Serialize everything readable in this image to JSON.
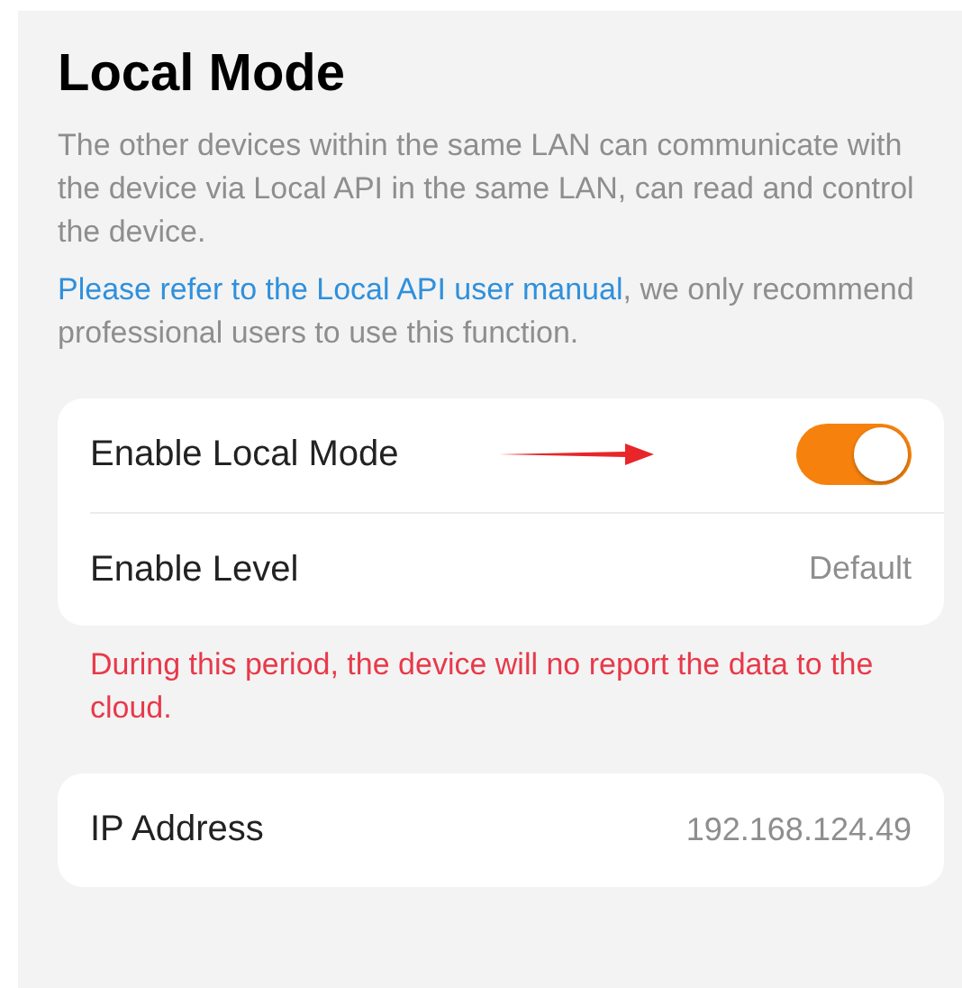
{
  "title": "Local Mode",
  "description": "The other devices within the same LAN can communicate with the device via Local API in the same LAN, can read and control the device.",
  "notice": {
    "link": "Please refer to the Local API user manual",
    "text": ", we only recommend professional users to use this function."
  },
  "groups": [
    {
      "rows": [
        {
          "kind": "toggle",
          "label": "Enable Local Mode",
          "on": true,
          "annotated": true
        },
        {
          "kind": "value",
          "label": "Enable Level",
          "value": "Default"
        }
      ],
      "warning": "During this period, the device will no report the data to the cloud."
    },
    {
      "rows": [
        {
          "kind": "value",
          "label": "IP Address",
          "value": "192.168.124.49"
        }
      ]
    }
  ]
}
